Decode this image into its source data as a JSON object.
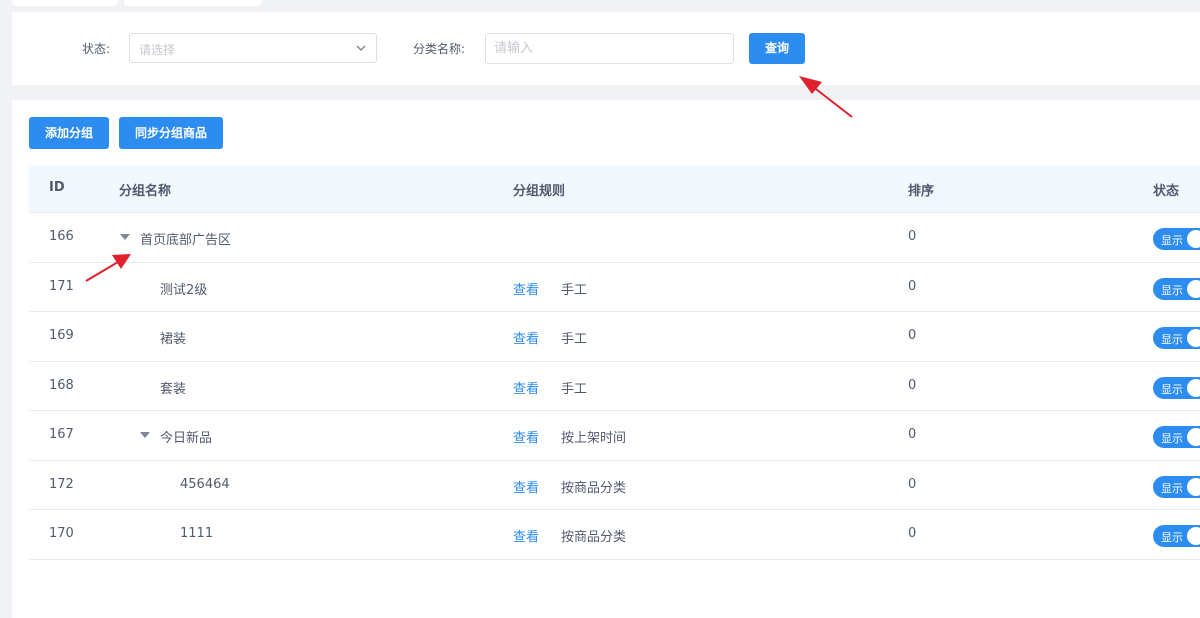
{
  "filter": {
    "status_label": "状态:",
    "status_placeholder": "请选择",
    "name_label": "分类名称:",
    "name_placeholder": "请输入",
    "query_button": "查询"
  },
  "toolbar": {
    "add_button": "添加分组",
    "sync_button": "同步分组商品"
  },
  "table": {
    "headers": {
      "id": "ID",
      "name": "分组名称",
      "rule": "分组规则",
      "sort": "排序",
      "status": "状态"
    },
    "view_link": "查看",
    "switch_label": "显示",
    "rows": [
      {
        "id": "166",
        "name": "首页底部广告区",
        "level": 0,
        "expandable": true,
        "rule": "",
        "has_link": false,
        "sort": "0"
      },
      {
        "id": "171",
        "name": "测试2级",
        "level": 1,
        "expandable": false,
        "rule": "手工",
        "has_link": true,
        "sort": "0"
      },
      {
        "id": "169",
        "name": "裙装",
        "level": 1,
        "expandable": false,
        "rule": "手工",
        "has_link": true,
        "sort": "0"
      },
      {
        "id": "168",
        "name": "套装",
        "level": 1,
        "expandable": false,
        "rule": "手工",
        "has_link": true,
        "sort": "0"
      },
      {
        "id": "167",
        "name": "今日新品",
        "level": 1,
        "expandable": true,
        "rule": "按上架时间",
        "has_link": true,
        "sort": "0"
      },
      {
        "id": "172",
        "name": "456464",
        "level": 2,
        "expandable": false,
        "rule": "按商品分类",
        "has_link": true,
        "sort": "0"
      },
      {
        "id": "170",
        "name": "1111",
        "level": 2,
        "expandable": false,
        "rule": "按商品分类",
        "has_link": true,
        "sort": "0"
      }
    ]
  },
  "colors": {
    "primary": "#2d8cf0",
    "annotation_arrow": "#e0202b"
  },
  "icons": {
    "select_arrow": "chevron-down-icon",
    "tree_toggle": "caret-down-icon"
  }
}
